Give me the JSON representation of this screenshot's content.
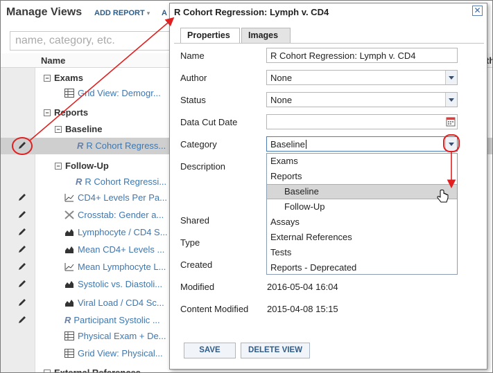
{
  "background": {
    "title": "Manage Views",
    "add_report_label": "ADD REPORT",
    "add_report_arrow": "▾",
    "second_button_label": "A",
    "search_placeholder": "name, category, etc.",
    "column_name": "Name",
    "column_right_partial": "th",
    "tree": {
      "exams": "Exams",
      "exams_grid": "Grid View: Demogr...",
      "reports": "Reports",
      "baseline": "Baseline",
      "baseline_item": "R Cohort Regress...",
      "follow_up": "Follow-Up",
      "items": [
        "R Cohort Regressi...",
        "CD4+ Levels Per Pa...",
        "Crosstab: Gender a...",
        "Lymphocyte / CD4 S...",
        "Mean CD4+ Levels ...",
        "Mean Lymphocyte L...",
        "Systolic vs. Diastoli...",
        "Viral Load / CD4 Sc...",
        "Participant Systolic ...",
        "Physical Exam + De...",
        "Grid View: Physical..."
      ],
      "external": "External References"
    }
  },
  "dialog": {
    "title": "R Cohort Regression: Lymph v. CD4",
    "close_glyph": "✕",
    "tabs": [
      "Properties",
      "Images"
    ],
    "fields": {
      "name_label": "Name",
      "name_value": "R Cohort Regression: Lymph v. CD4",
      "author_label": "Author",
      "author_value": "None",
      "status_label": "Status",
      "status_value": "None",
      "data_cut_date_label": "Data Cut Date",
      "data_cut_date_value": "",
      "category_label": "Category",
      "category_value": "Baseline",
      "description_label": "Description",
      "shared_label": "Shared",
      "type_label": "Type",
      "created_label": "Created",
      "modified_label": "Modified",
      "modified_value": "2016-05-04 16:04",
      "content_modified_label": "Content Modified",
      "content_modified_value": "2015-04-08 15:15"
    },
    "category_options": [
      {
        "label": "Exams",
        "indent": false
      },
      {
        "label": "Reports",
        "indent": false
      },
      {
        "label": "Baseline",
        "indent": true,
        "highlighted": true
      },
      {
        "label": "Follow-Up",
        "indent": true
      },
      {
        "label": "Assays",
        "indent": false
      },
      {
        "label": "External References",
        "indent": false
      },
      {
        "label": "Tests",
        "indent": false
      },
      {
        "label": "Reports - Deprecated",
        "indent": false
      }
    ],
    "save_label": "SAVE",
    "delete_label": "DELETE VIEW"
  },
  "colors": {
    "annotation_red": "#e02020",
    "link_blue": "#3d77b0",
    "button_text": "#2d5c8c"
  }
}
